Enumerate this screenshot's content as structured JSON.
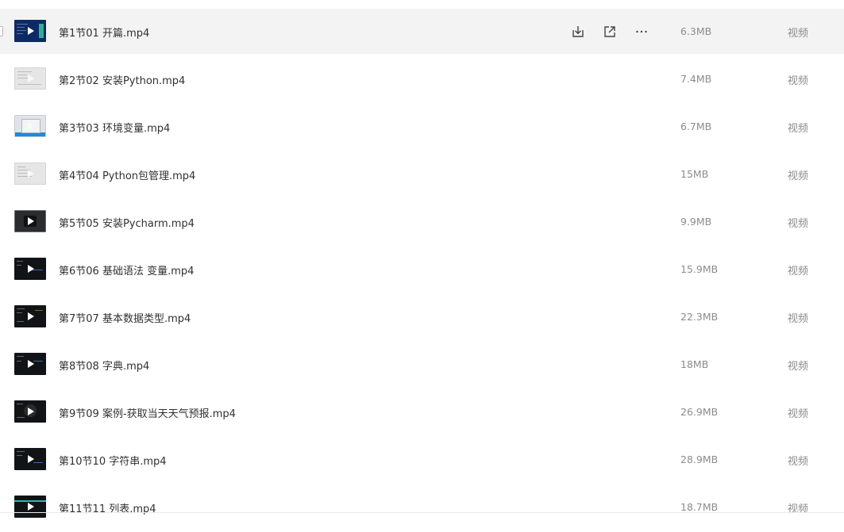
{
  "files": [
    {
      "name": "第1节01 开篇.mp4",
      "size": "6.3MB",
      "type": "视频",
      "thumb": "blue-code",
      "hover": true
    },
    {
      "name": "第2节02 安装Python.mp4",
      "size": "7.4MB",
      "type": "视频",
      "thumb": "light-window"
    },
    {
      "name": "第3节03 环境变量.mp4",
      "size": "6.7MB",
      "type": "视频",
      "thumb": "windows-dialog"
    },
    {
      "name": "第4节04 Python包管理.mp4",
      "size": "15MB",
      "type": "视频",
      "thumb": "light-window"
    },
    {
      "name": "第5节05 安装Pycharm.mp4",
      "size": "9.9MB",
      "type": "视频",
      "thumb": "gray-window"
    },
    {
      "name": "第6节06 基础语法 变量.mp4",
      "size": "15.9MB",
      "type": "视频",
      "thumb": "dark-ide"
    },
    {
      "name": "第7节07 基本数据类型.mp4",
      "size": "22.3MB",
      "type": "视频",
      "thumb": "dark-ide"
    },
    {
      "name": "第8节08 字典.mp4",
      "size": "18MB",
      "type": "视频",
      "thumb": "dark-ide"
    },
    {
      "name": "第9节09 案例-获取当天天气预报.mp4",
      "size": "26.9MB",
      "type": "视频",
      "thumb": "dark-ide"
    },
    {
      "name": "第10节10 字符串.mp4",
      "size": "28.9MB",
      "type": "视频",
      "thumb": "dark-ide"
    },
    {
      "name": "第11节11 列表.mp4",
      "size": "18.7MB",
      "type": "视频",
      "thumb": "dark-ide-teal"
    }
  ],
  "row_actions": [
    "download-icon",
    "share-icon",
    "more-icon"
  ],
  "colors": {
    "hover_bg": "#f3f3f4",
    "text": "#303133",
    "muted": "#8c8c8c"
  }
}
